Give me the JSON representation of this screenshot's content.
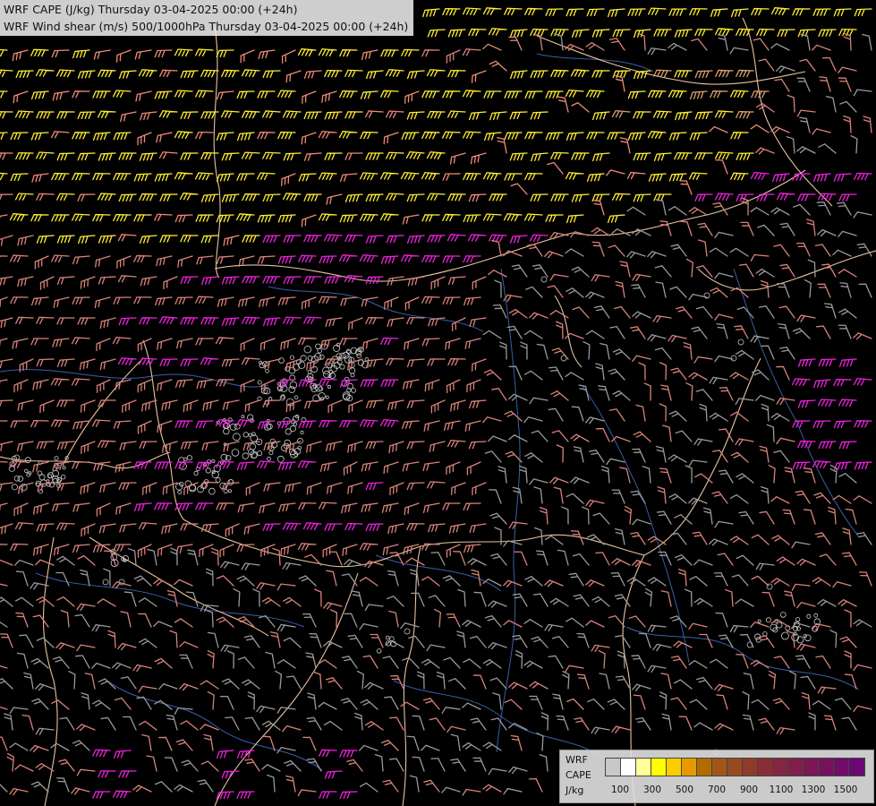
{
  "title_line1": "WRF CAPE (J/kg) Thursday 03-04-2025 00:00 (+24h)",
  "title_line2": "WRF Wind shear (m/s) 500/1000hPa Thursday 03-04-2025 00:00 (+24h)",
  "legend": {
    "label_line1": "WRF",
    "label_line2": "CAPE",
    "label_line3": "J/kg",
    "colors": [
      "#c8c8c8",
      "#ffffff",
      "#ffff99",
      "#ffff00",
      "#ffcc00",
      "#e69a00",
      "#b36b00",
      "#a0561a",
      "#974a20",
      "#8f3a2a",
      "#8a2e35",
      "#852640",
      "#801f4a",
      "#7a1854",
      "#75125e",
      "#700d68",
      "#6b0872"
    ],
    "tick_labels": [
      "100",
      "300",
      "500",
      "700",
      "900",
      "1100",
      "1300",
      "1500"
    ]
  },
  "wind_shear_colors": {
    "gray": "#9a9a9a",
    "salmon": "#d8837a",
    "light_salmon": "#f08a78",
    "magenta": "#ee22dd",
    "yellow": "#ffee33",
    "tan": "#d9a070"
  },
  "map_colors": {
    "border": "#e8c2a0",
    "river": "#3a5fa8",
    "cape_contour": "#cccccc"
  }
}
